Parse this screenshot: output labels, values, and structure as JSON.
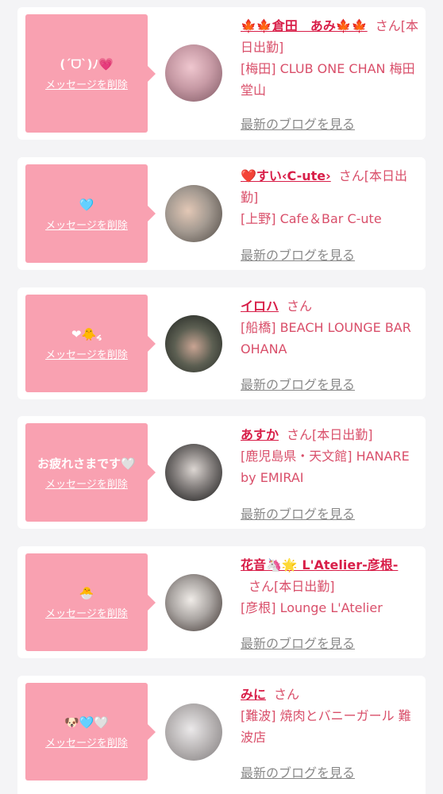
{
  "entries": [
    {
      "message": "(ˊᗜˋ)ﾉ💗",
      "delete_label": "メッセージを削除",
      "name": "🍁🍁倉田　あみ🍁🍁",
      "honorific": "さん",
      "status": "[本日出勤]",
      "location": "[梅田] CLUB ONE CHAN 梅田堂山",
      "blog_label": "最新のブログを見る",
      "avatar_colors": [
        "#efc7cf",
        "#7b5560"
      ]
    },
    {
      "message": "🩵",
      "delete_label": "メッセージを削除",
      "name": "❤️すい‹C-ute›",
      "honorific": "さん",
      "status": "[本日出勤]",
      "location": "[上野] Cafe＆Bar C-ute",
      "blog_label": "最新のブログを見る",
      "avatar_colors": [
        "#d9d6d3",
        "#4c4641"
      ]
    },
    {
      "message": "❤︎🐥៹",
      "delete_label": "メッセージを削除",
      "name": "イロハ",
      "honorific": "さん",
      "status": "",
      "location": "[船橋] BEACH LOUNGE BAR OHANA",
      "blog_label": "最新のブログを見る",
      "avatar_colors": [
        "#5c5f52",
        "#1b1e1c"
      ]
    },
    {
      "message": "お疲れさまです🤍",
      "delete_label": "メッセージを削除",
      "name": "あすか",
      "honorific": "さん",
      "status": "[本日出勤]",
      "location": "[鹿児島県・天文館] HANARE by EMIRAI",
      "blog_label": "最新のブログを見る",
      "avatar_colors": [
        "#c0bdbb",
        "#151515"
      ]
    },
    {
      "message": "🐣",
      "delete_label": "メッセージを削除",
      "name": "花音🦄🌟 L'Atelier-彦根-",
      "honorific": "さん",
      "status": "[本日出勤]",
      "location": "[彦根] Lounge L'Atelier",
      "blog_label": "最新のブログを見る",
      "avatar_colors": [
        "#d6d8da",
        "#3a2f2c"
      ]
    },
    {
      "message": "🐶🩵🤍",
      "delete_label": "メッセージを削除",
      "name": "みに",
      "honorific": "さん",
      "status": "",
      "location": "[難波] 焼肉とバニーガール 難波店",
      "blog_label": "最新のブログを見る",
      "avatar_colors": [
        "#ebe9ea",
        "#7e7a7b"
      ]
    }
  ]
}
